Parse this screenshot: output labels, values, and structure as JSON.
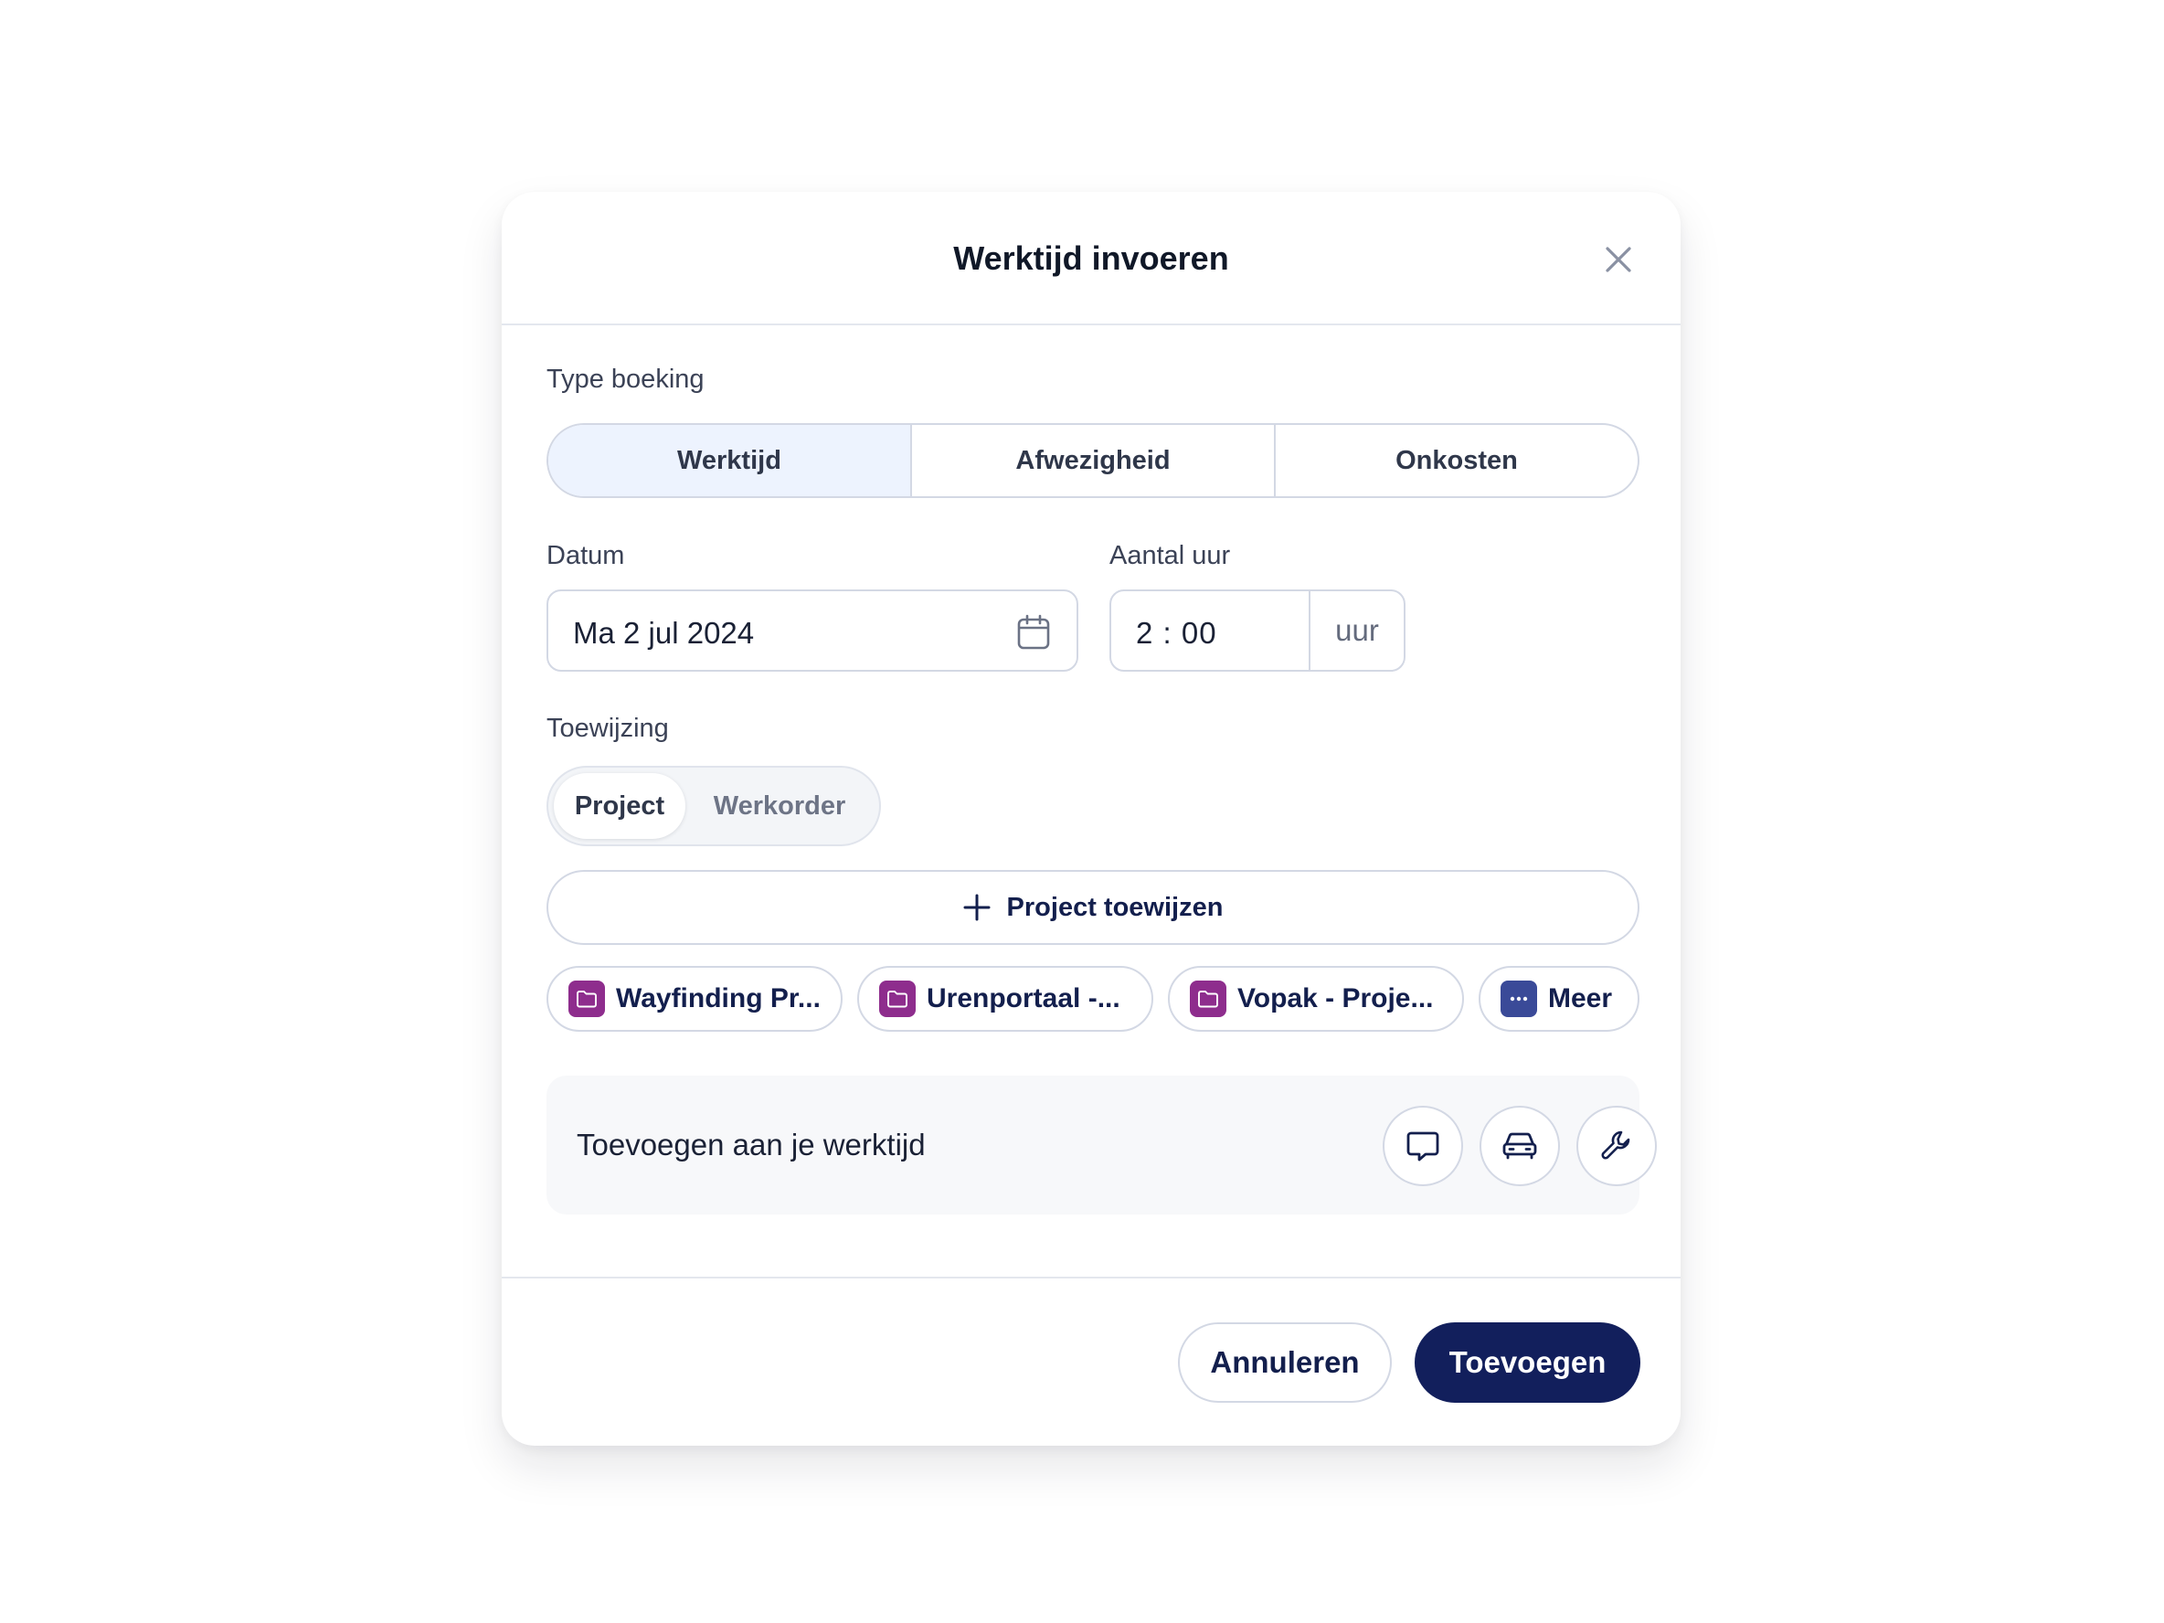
{
  "modal": {
    "title": "Werktijd invoeren",
    "close_icon": "close-icon"
  },
  "booking_type": {
    "label": "Type boeking",
    "options": [
      "Werktijd",
      "Afwezigheid",
      "Onkosten"
    ],
    "selected": "Werktijd"
  },
  "date": {
    "label": "Datum",
    "value": "Ma 2 jul 2024",
    "icon": "calendar-icon"
  },
  "hours": {
    "label": "Aantal uur",
    "value": "2 : 00",
    "unit": "uur"
  },
  "assignment": {
    "label": "Toewijzing",
    "options": [
      "Project",
      "Werkorder"
    ],
    "selected": "Project",
    "assign_button": "Project toewijzen",
    "chips": [
      "Wayfinding Pr...",
      "Urenportaal -...",
      "Vopak - Proje..."
    ],
    "more_label": "Meer"
  },
  "extras": {
    "label": "Toevoegen aan je werktijd",
    "actions": [
      "comment-icon",
      "car-icon",
      "wrench-icon"
    ]
  },
  "footer": {
    "cancel_label": "Annuleren",
    "submit_label": "Toevoegen"
  },
  "colors": {
    "primary": "#121f5c",
    "selected_segment": "#edf3fe",
    "folder_badge": "#8e2d8d",
    "more_badge": "#3a4a98",
    "border": "#d3d8e4"
  }
}
